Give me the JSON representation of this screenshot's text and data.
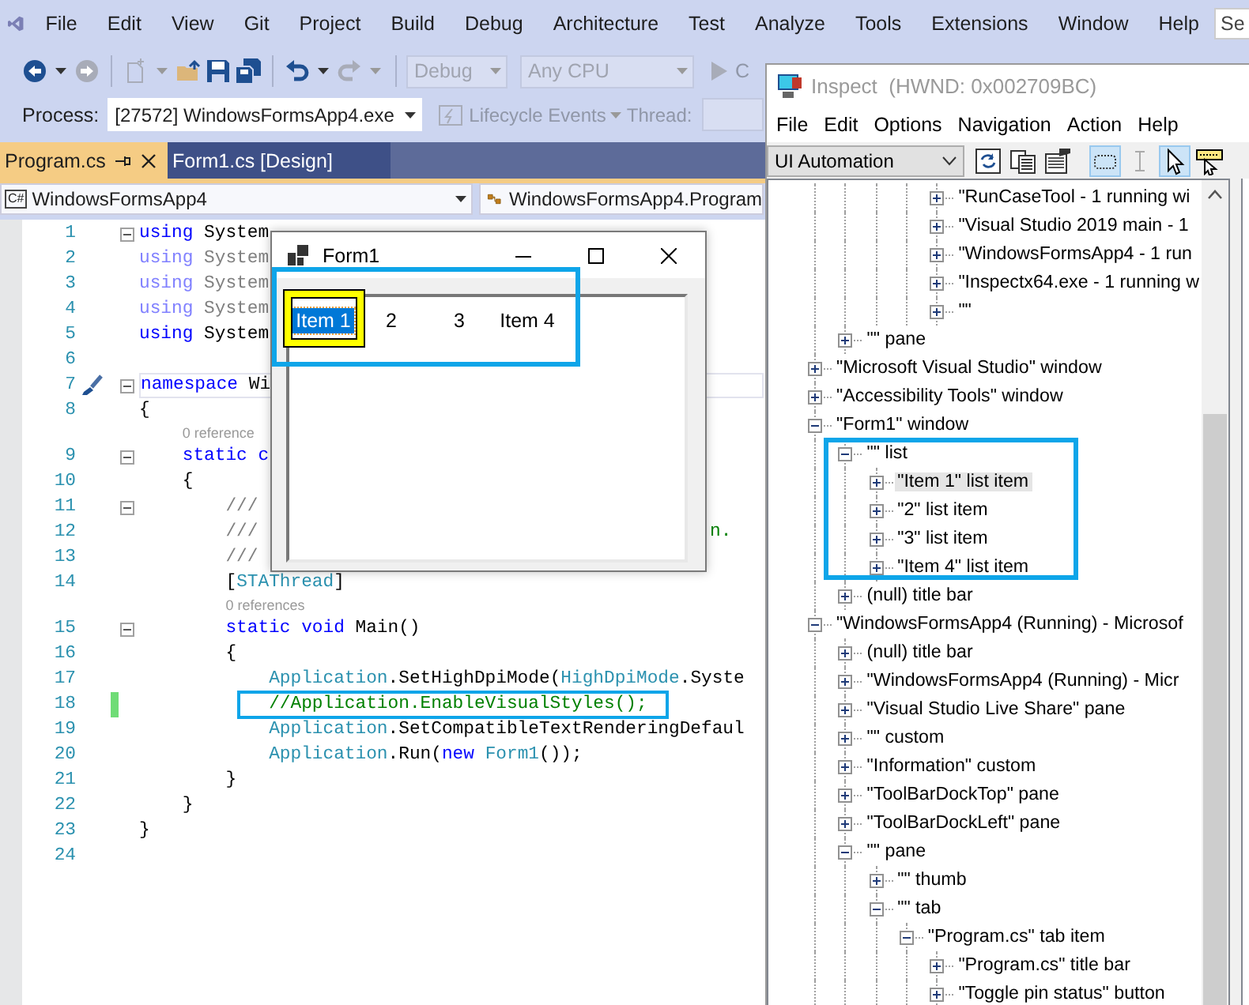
{
  "vs": {
    "menu": [
      "File",
      "Edit",
      "View",
      "Git",
      "Project",
      "Build",
      "Debug",
      "Architecture",
      "Test",
      "Analyze",
      "Tools",
      "Extensions",
      "Window",
      "Help"
    ],
    "search": {
      "placeholder": "Se"
    },
    "toolbar": {
      "combos": [
        {
          "value": "Debug",
          "disabled": true
        },
        {
          "value": "Any CPU",
          "disabled": true
        }
      ],
      "start": {
        "label": "C",
        "disabled": true
      }
    },
    "debug_bar": {
      "process_label": "Process:",
      "process": "[27572] WindowsFormsApp4.exe",
      "lifecycle": "Lifecycle Events",
      "thread_label": "Thread:"
    },
    "tabs": [
      {
        "label": "Program.cs",
        "selected": true
      },
      {
        "label": "Form1.cs [Design]",
        "selected": false
      }
    ],
    "nav": {
      "language": "C#",
      "project": "WindowsFormsApp4",
      "type": "WindowsFormsApp4.Program"
    },
    "code": [
      {
        "n": "1",
        "fold": true,
        "tokens": [
          {
            "kind": "kw",
            "t": "using"
          },
          {
            "kind": "pl",
            "t": " System"
          }
        ]
      },
      {
        "n": "2",
        "tokens": [
          {
            "kind": "fkw",
            "t": "using"
          },
          {
            "kind": "fpl",
            "t": " System"
          }
        ]
      },
      {
        "n": "3",
        "tokens": [
          {
            "kind": "fkw",
            "t": "using"
          },
          {
            "kind": "fpl",
            "t": " System"
          }
        ]
      },
      {
        "n": "4",
        "tokens": [
          {
            "kind": "fkw",
            "t": "using"
          },
          {
            "kind": "fpl",
            "t": " System"
          }
        ]
      },
      {
        "n": "5",
        "tokens": [
          {
            "kind": "kw",
            "t": "using"
          },
          {
            "kind": "pl",
            "t": " System"
          }
        ]
      },
      {
        "n": "6"
      },
      {
        "n": "7",
        "fold": true,
        "current": true,
        "gutter": {
          "kind": "brush"
        },
        "tokens": [
          {
            "kind": "kw",
            "t": "namespace"
          },
          {
            "kind": "pl",
            "t": " Wi"
          }
        ]
      },
      {
        "n": "8",
        "tokens": [
          {
            "kind": "pl",
            "t": "{"
          }
        ]
      },
      {
        "n": "9",
        "lens": "0 reference",
        "fold": true,
        "tokens": [
          {
            "kind": "kw",
            "t": "    static c"
          }
        ]
      },
      {
        "n": "10",
        "tokens": [
          {
            "kind": "pl",
            "t": "    {"
          }
        ]
      },
      {
        "n": "11",
        "fold": true,
        "tokens": [
          {
            "kind": "doc",
            "t": "        ///"
          }
        ]
      },
      {
        "n": "12",
        "tokens": [
          {
            "kind": "doc",
            "t": "        ///"
          },
          {
            "kind": "cm",
            "t": "n.",
            "clipped": true
          }
        ]
      },
      {
        "n": "13",
        "tokens": [
          {
            "kind": "doc",
            "t": "        ///"
          }
        ]
      },
      {
        "n": "14",
        "tokens": [
          {
            "kind": "pl",
            "t": "        ["
          },
          {
            "kind": "ty",
            "t": "STAThread"
          },
          {
            "kind": "pl",
            "t": "]"
          }
        ]
      },
      {
        "n": "15",
        "lens": "0 references",
        "fold": true,
        "tokens": [
          {
            "kind": "kw",
            "t": "        static"
          },
          {
            "kind": "kw",
            "t": " void"
          },
          {
            "kind": "pl",
            "t": " Main()"
          }
        ]
      },
      {
        "n": "16",
        "tokens": [
          {
            "kind": "pl",
            "t": "        {"
          }
        ]
      },
      {
        "n": "17",
        "tokens": [
          {
            "kind": "ty",
            "t": "            Application"
          },
          {
            "kind": "pl",
            "t": ".SetHighDpiMode("
          },
          {
            "kind": "ty",
            "t": "HighDpiMode"
          },
          {
            "kind": "pl",
            "t": ".Syste"
          }
        ]
      },
      {
        "n": "18",
        "changed": true,
        "annotated": true,
        "tokens": [
          {
            "kind": "cm",
            "t": "            //Application.EnableVisualStyles();"
          }
        ]
      },
      {
        "n": "19",
        "tokens": [
          {
            "kind": "ty",
            "t": "            Application"
          },
          {
            "kind": "pl",
            "t": ".SetCompatibleTextRenderingDefaul"
          }
        ]
      },
      {
        "n": "20",
        "tokens": [
          {
            "kind": "ty",
            "t": "            Application"
          },
          {
            "kind": "pl",
            "t": ".Run("
          },
          {
            "kind": "kw",
            "t": "new"
          },
          {
            "kind": "ty",
            "t": " Form1"
          },
          {
            "kind": "pl",
            "t": "());"
          }
        ]
      },
      {
        "n": "21",
        "tokens": [
          {
            "kind": "pl",
            "t": "        }"
          }
        ]
      },
      {
        "n": "22",
        "tokens": [
          {
            "kind": "pl",
            "t": "    }"
          }
        ]
      },
      {
        "n": "23",
        "tokens": [
          {
            "kind": "pl",
            "t": "}"
          }
        ]
      },
      {
        "n": "24"
      }
    ]
  },
  "form": {
    "title": "Form1",
    "items": [
      {
        "label": "Item 1",
        "selected": true,
        "highlighted": true
      },
      {
        "label": "2",
        "selected": false,
        "highlighted": false
      },
      {
        "label": "3",
        "selected": false,
        "highlighted": false
      },
      {
        "label": "Item 4",
        "selected": false,
        "highlighted": false
      }
    ]
  },
  "inspect": {
    "title": "Inspect  (HWND: 0x002709BC)",
    "menu": [
      "File",
      "Edit",
      "Options",
      "Navigation",
      "Action",
      "Help"
    ],
    "mode": "UI Automation",
    "tools": [
      {
        "kind": "refresh",
        "pressed": false
      },
      {
        "kind": "copy",
        "pressed": false
      },
      {
        "kind": "properties",
        "pressed": false
      },
      {
        "kind": "rectangle",
        "pressed": true
      },
      {
        "kind": "caret",
        "pressed": false
      },
      {
        "kind": "pointer",
        "pressed": true
      },
      {
        "kind": "tooltip",
        "pressed": false
      }
    ],
    "tree": [
      {
        "children": [
          {
            "children": [
              {
                "children": [
                  {
                    "children": [
                      {
                        "label": "\"RunCaseTool - 1 running wi",
                        "expanded": false,
                        "selected": false
                      },
                      {
                        "label": "\"Visual Studio 2019 main - 1",
                        "expanded": false,
                        "selected": false
                      },
                      {
                        "label": "\"WindowsFormsApp4 - 1 run",
                        "expanded": false,
                        "selected": false
                      },
                      {
                        "label": "\"Inspectx64.exe - 1 running w",
                        "expanded": false,
                        "selected": false
                      },
                      {
                        "label": "\"\"",
                        "expanded": false,
                        "selected": false
                      }
                    ]
                  }
                ]
              }
            ]
          },
          {
            "label": "\"\" pane",
            "expanded": false,
            "selected": false
          }
        ]
      },
      {
        "label": "\"Microsoft Visual Studio\" window",
        "expanded": false,
        "selected": false
      },
      {
        "label": "\"Accessibility Tools\" window",
        "expanded": false,
        "selected": false
      },
      {
        "label": "\"Form1\" window",
        "expanded": true,
        "selected": false,
        "children": [
          {
            "label": "\"\" list",
            "expanded": true,
            "selected": false,
            "children": [
              {
                "label": "\"Item 1\" list item",
                "expanded": false,
                "selected": true
              },
              {
                "label": "\"2\" list item",
                "expanded": false,
                "selected": false
              },
              {
                "label": "\"3\" list item",
                "expanded": false,
                "selected": false
              },
              {
                "label": "\"Item 4\" list item",
                "expanded": false,
                "selected": false
              }
            ]
          },
          {
            "label": "(null) title bar",
            "expanded": false,
            "selected": false
          }
        ]
      },
      {
        "label": "\"WindowsFormsApp4 (Running) - Microsof",
        "expanded": true,
        "selected": false,
        "children": [
          {
            "label": "(null) title bar",
            "expanded": false,
            "selected": false
          },
          {
            "label": "\"WindowsFormsApp4 (Running) - Micr",
            "expanded": false,
            "selected": false
          },
          {
            "label": "\"Visual Studio Live Share\" pane",
            "expanded": false,
            "selected": false
          },
          {
            "label": "\"\" custom",
            "expanded": false,
            "selected": false
          },
          {
            "label": "\"Information\" custom",
            "expanded": false,
            "selected": false
          },
          {
            "label": "\"ToolBarDockTop\" pane",
            "expanded": false,
            "selected": false
          },
          {
            "label": "\"ToolBarDockLeft\" pane",
            "expanded": false,
            "selected": false
          },
          {
            "label": "\"\" pane",
            "expanded": true,
            "selected": false,
            "children": [
              {
                "label": "\"\" thumb",
                "expanded": false,
                "selected": false
              },
              {
                "label": "\"\" tab",
                "expanded": true,
                "selected": false,
                "children": [
                  {
                    "label": "\"Program.cs\" tab item",
                    "expanded": true,
                    "selected": false,
                    "children": [
                      {
                        "label": "\"Program.cs\" title bar",
                        "expanded": false,
                        "selected": false
                      },
                      {
                        "label": "\"Toggle pin status\" button",
                        "expanded": false,
                        "selected": false
                      }
                    ]
                  }
                ]
              }
            ]
          }
        ]
      }
    ]
  }
}
